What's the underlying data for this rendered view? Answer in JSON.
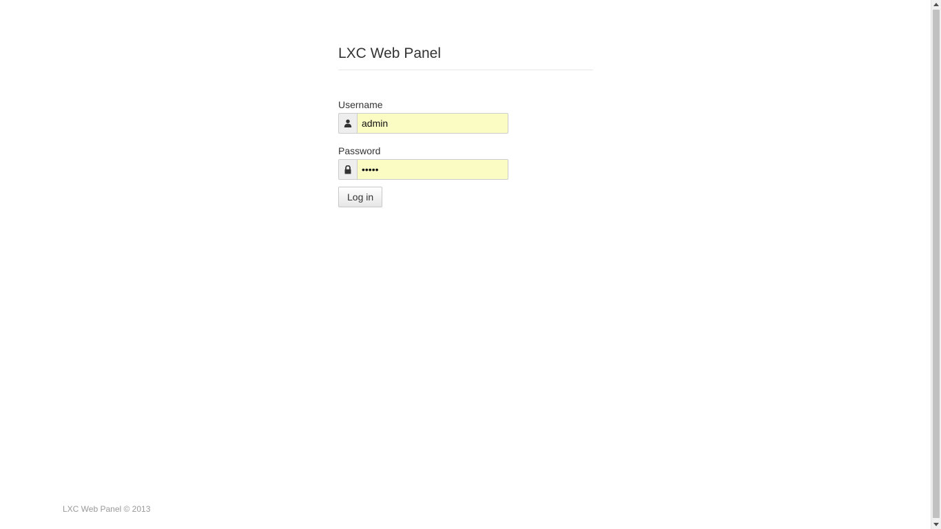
{
  "header": {
    "title": "LXC Web Panel"
  },
  "login_form": {
    "username_label": "Username",
    "username_value": "admin",
    "username_icon": "user-icon",
    "password_label": "Password",
    "password_value": "•••••",
    "password_icon": "lock-icon",
    "submit_label": "Log in",
    "input_autofill_color": "#fafcc4"
  },
  "footer": {
    "text": "LXC Web Panel © 2013"
  }
}
